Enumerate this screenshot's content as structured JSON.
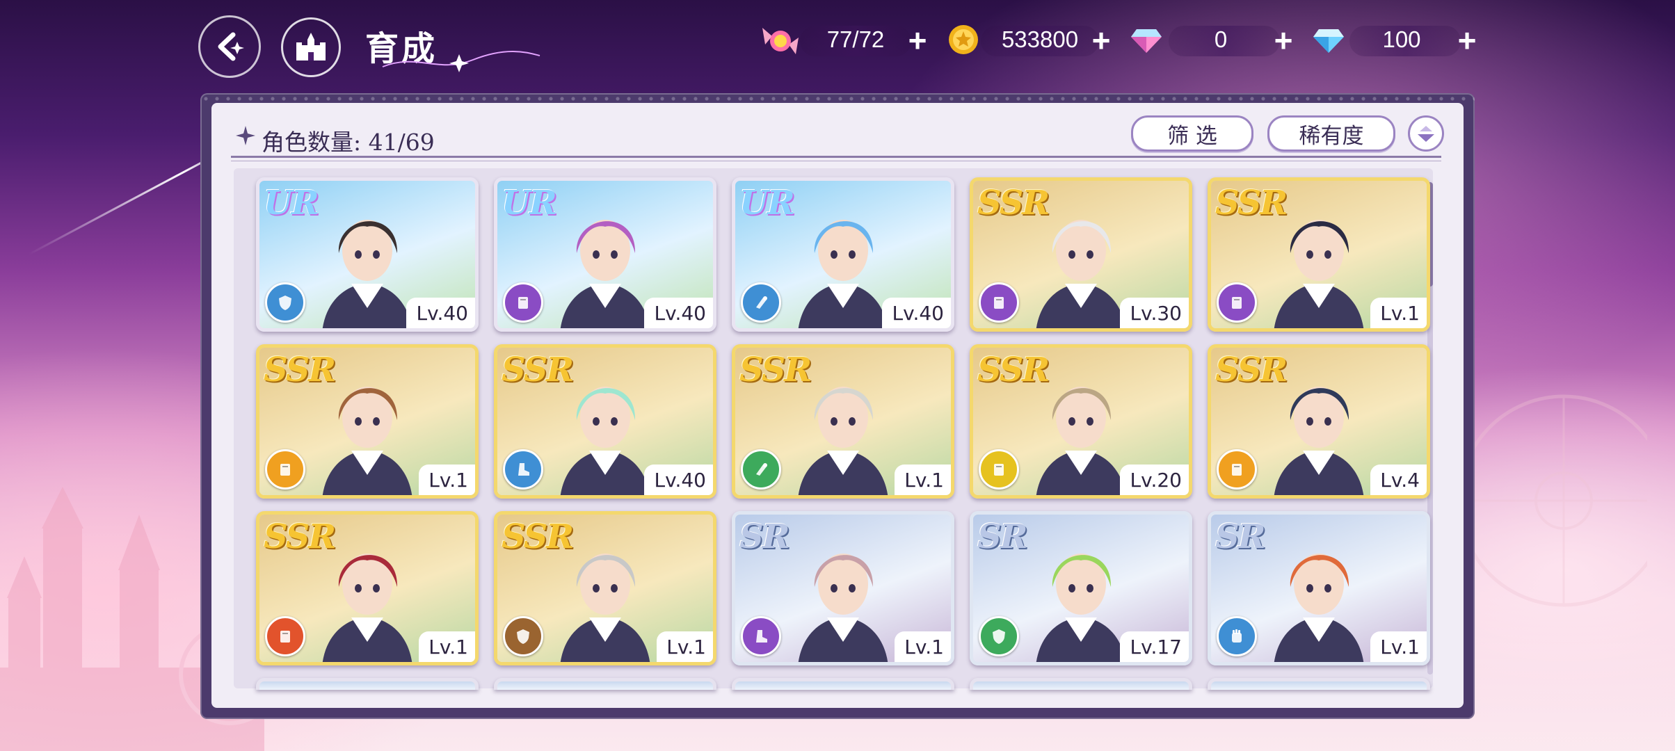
{
  "header": {
    "title": "育成",
    "resources": [
      {
        "name": "candy",
        "value": "77/72",
        "icon": "candy-icon"
      },
      {
        "name": "gold",
        "value": "533800",
        "icon": "gold-coin-icon"
      },
      {
        "name": "paid-gem",
        "value": "0",
        "icon": "pink-gem-icon"
      },
      {
        "name": "free-gem",
        "value": "100",
        "icon": "blue-gem-icon"
      }
    ],
    "plus": "+"
  },
  "panel": {
    "count_label": "角色数量:",
    "count_value": "41/69",
    "filter_label": "筛 选",
    "sort_label": "稀有度"
  },
  "colors": {
    "ur_border": "#e9e4f2",
    "ssr_border": "#f4d86d",
    "sr_border": "#dfe6f2",
    "attr_blue": "#3f8fd4",
    "attr_purple": "#8a4cc4",
    "attr_orange": "#f0a020",
    "attr_green": "#3daa5c",
    "attr_yellow": "#e6c21f",
    "attr_red": "#e2532c",
    "attr_brown": "#9a6430"
  },
  "cards": [
    {
      "rarity": "UR",
      "level": "Lv.40",
      "attr": "blue",
      "attr_icon": "shield-icon"
    },
    {
      "rarity": "UR",
      "level": "Lv.40",
      "attr": "purple",
      "attr_icon": "book-icon"
    },
    {
      "rarity": "UR",
      "level": "Lv.40",
      "attr": "blue",
      "attr_icon": "horn-icon"
    },
    {
      "rarity": "SSR",
      "level": "Lv.30",
      "attr": "purple",
      "attr_icon": "book-icon"
    },
    {
      "rarity": "SSR",
      "level": "Lv.1",
      "attr": "purple",
      "attr_icon": "book-icon"
    },
    {
      "rarity": "SSR",
      "level": "Lv.1",
      "attr": "orange",
      "attr_icon": "book-icon"
    },
    {
      "rarity": "SSR",
      "level": "Lv.40",
      "attr": "blue",
      "attr_icon": "boot-icon"
    },
    {
      "rarity": "SSR",
      "level": "Lv.1",
      "attr": "green",
      "attr_icon": "horn-icon"
    },
    {
      "rarity": "SSR",
      "level": "Lv.20",
      "attr": "yellow",
      "attr_icon": "book-icon"
    },
    {
      "rarity": "SSR",
      "level": "Lv.4",
      "attr": "orange",
      "attr_icon": "book-icon"
    },
    {
      "rarity": "SSR",
      "level": "Lv.1",
      "attr": "red",
      "attr_icon": "book-icon"
    },
    {
      "rarity": "SSR",
      "level": "Lv.1",
      "attr": "brown",
      "attr_icon": "shield-icon"
    },
    {
      "rarity": "SR",
      "level": "Lv.1",
      "attr": "purple",
      "attr_icon": "boot-icon"
    },
    {
      "rarity": "SR",
      "level": "Lv.17",
      "attr": "green",
      "attr_icon": "shield-icon"
    },
    {
      "rarity": "SR",
      "level": "Lv.1",
      "attr": "blue",
      "attr_icon": "fist-icon"
    }
  ]
}
